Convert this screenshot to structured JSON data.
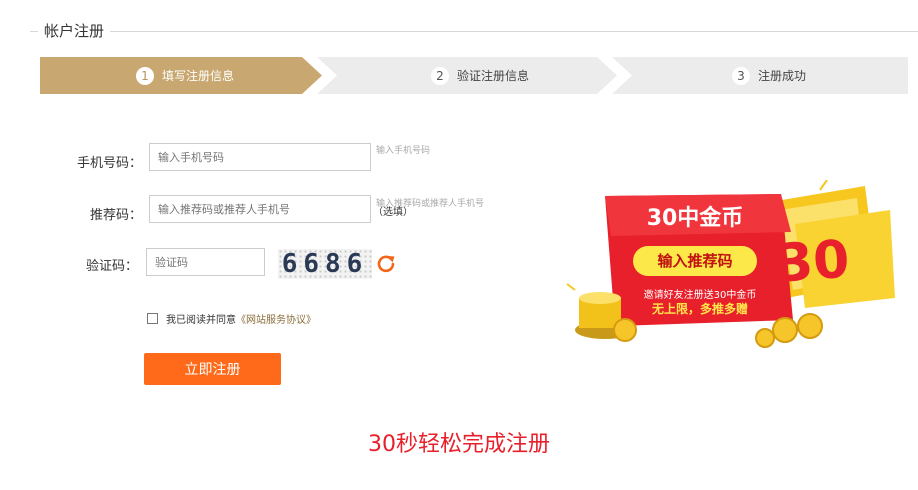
{
  "header": {
    "title": "帐户注册"
  },
  "steps": [
    {
      "num": "1",
      "label": "填写注册信息",
      "active": true
    },
    {
      "num": "2",
      "label": "验证注册信息",
      "active": false
    },
    {
      "num": "3",
      "label": "注册成功",
      "active": false
    }
  ],
  "form": {
    "phone": {
      "label": "手机号码：",
      "placeholder": "输入手机号码",
      "hint": "输入手机号码"
    },
    "referrer": {
      "label": "推荐码：",
      "placeholder": "输入推荐码或推荐人手机号",
      "hint": "输入推荐码或推荐人手机号",
      "optional": "（选填）"
    },
    "captcha": {
      "label": "验证码：",
      "placeholder": "验证码",
      "code": "6686"
    },
    "agree": {
      "text": "我已阅读并同意",
      "link": "《网站服务协议》"
    },
    "submit_label": "立即注册"
  },
  "promo": {
    "title": "30中金币",
    "button": "输入推荐码",
    "line1": "邀请好友注册送30中金币",
    "line2": "无上限，多推多赠",
    "big": "30"
  },
  "footer": {
    "text": "30秒轻松完成注册"
  },
  "colors": {
    "step_active": "#c8a870",
    "step_inactive": "#ececec",
    "submit": "#ff6a1a",
    "accent_red": "#e8202b",
    "promo_yellow": "#fde84a"
  }
}
